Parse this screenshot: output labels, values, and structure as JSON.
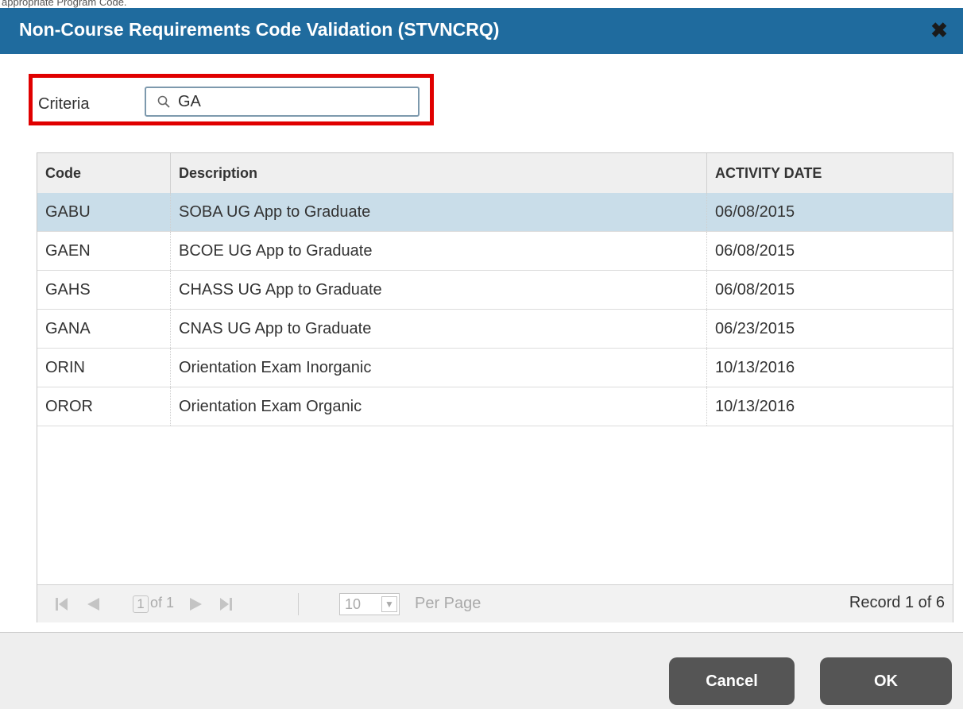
{
  "caption": "appropriate Program Code.",
  "dialog": {
    "title": "Non-Course Requirements Code Validation (STVNCRQ)",
    "close_icon": "close-icon",
    "close_glyph": "✖"
  },
  "criteria": {
    "label": "Criteria",
    "value": "GA",
    "icon": "search-icon"
  },
  "grid": {
    "columns": [
      "Code",
      "Description",
      "ACTIVITY DATE"
    ],
    "rows": [
      {
        "code": "GABU",
        "description": "SOBA UG App to Graduate",
        "activity_date": "06/08/2015",
        "selected": true
      },
      {
        "code": "GAEN",
        "description": "BCOE UG App to Graduate",
        "activity_date": "06/08/2015",
        "selected": false
      },
      {
        "code": "GAHS",
        "description": "CHASS UG App to Graduate",
        "activity_date": "06/08/2015",
        "selected": false
      },
      {
        "code": "GANA",
        "description": "CNAS UG App to Graduate",
        "activity_date": "06/23/2015",
        "selected": false
      },
      {
        "code": "ORIN",
        "description": "Orientation Exam Inorganic",
        "activity_date": "10/13/2016",
        "selected": false
      },
      {
        "code": "OROR",
        "description": "Orientation Exam Organic",
        "activity_date": "10/13/2016",
        "selected": false
      }
    ]
  },
  "pager": {
    "page": "1",
    "of_text": "of 1",
    "per_page_value": "10",
    "per_page_label": "Per Page",
    "record_text": "Record 1 of 6",
    "first_icon": "first-page-icon",
    "prev_icon": "previous-page-icon",
    "next_icon": "next-page-icon",
    "last_icon": "last-page-icon"
  },
  "footer": {
    "cancel_label": "Cancel",
    "ok_label": "OK"
  },
  "colors": {
    "titlebar": "#1f6b9e",
    "selected_row": "#c9dde9",
    "highlight_border": "#e00000",
    "button": "#555555"
  }
}
